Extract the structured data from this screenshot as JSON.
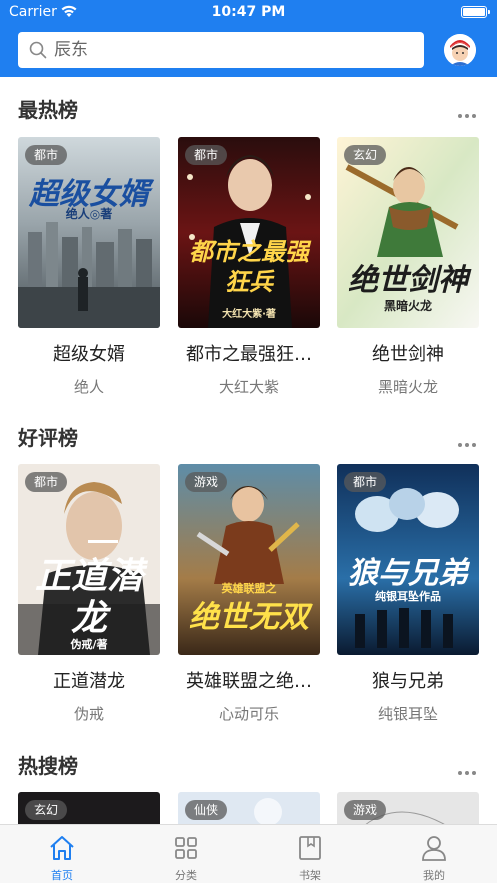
{
  "status_bar": {
    "carrier": "Carrier",
    "time": "10:47 PM",
    "battery_level": 1.0
  },
  "search": {
    "placeholder": "辰东"
  },
  "sections": [
    {
      "title": "最热榜",
      "books": [
        {
          "tag": "都市",
          "title": "超级女婿",
          "author": "绝人",
          "cover_text": "超级女婿",
          "cover_sub": "绝人◎著"
        },
        {
          "tag": "都市",
          "title": "都市之最强狂…",
          "author": "大红大紫",
          "cover_text": "都市之最强狂兵",
          "cover_sub": "大红大紫·著"
        },
        {
          "tag": "玄幻",
          "title": "绝世剑神",
          "author": "黑暗火龙",
          "cover_text": "绝世剑神",
          "cover_sub": "黑暗火龙"
        }
      ]
    },
    {
      "title": "好评榜",
      "books": [
        {
          "tag": "都市",
          "title": "正道潜龙",
          "author": "伪戒",
          "cover_text": "正道潜龙",
          "cover_sub": "伪戒/著"
        },
        {
          "tag": "游戏",
          "title": "英雄联盟之绝…",
          "author": "心动可乐",
          "cover_text": "绝世无双",
          "cover_sub": "英雄联盟之"
        },
        {
          "tag": "都市",
          "title": "狼与兄弟",
          "author": "纯银耳坠",
          "cover_text": "狼与兄弟",
          "cover_sub": "纯银耳坠作品"
        }
      ]
    },
    {
      "title": "热搜榜",
      "books": [
        {
          "tag": "玄幻"
        },
        {
          "tag": "仙侠"
        },
        {
          "tag": "游戏"
        }
      ]
    }
  ],
  "tabbar": [
    {
      "label": "首页",
      "icon": "home-icon",
      "active": true
    },
    {
      "label": "分类",
      "icon": "grid-icon",
      "active": false
    },
    {
      "label": "书架",
      "icon": "bookshelf-icon",
      "active": false
    },
    {
      "label": "我的",
      "icon": "user-icon",
      "active": false
    }
  ],
  "colors": {
    "accent": "#1f7ff0",
    "tag_bg": "#5a5a5a"
  }
}
